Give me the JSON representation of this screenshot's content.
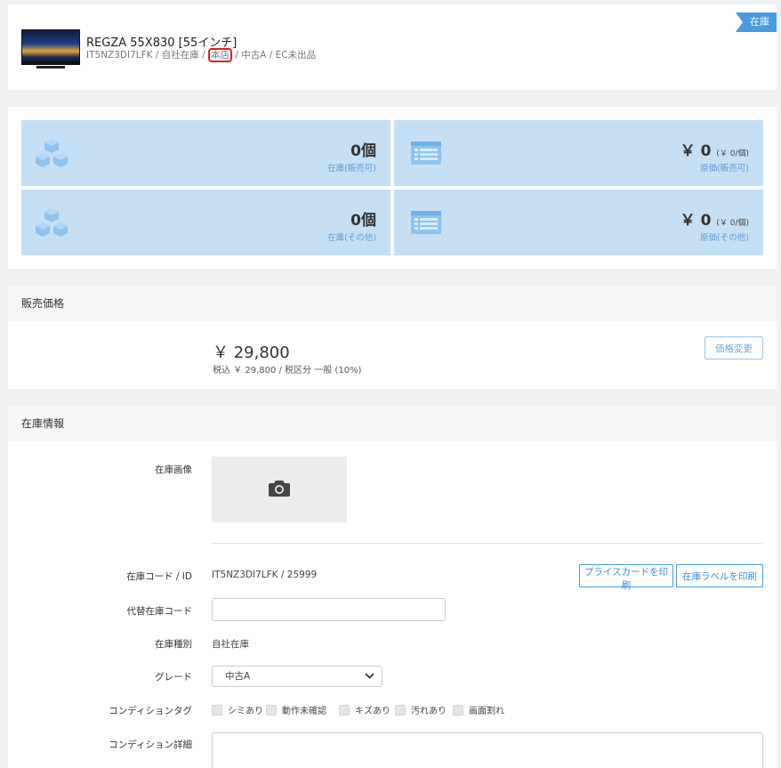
{
  "header": {
    "title": "REGZA 55X830 [55インチ]",
    "sub_prefix": "IT5NZ3DI7LFK / 自社在庫 /",
    "sub_store": "本店",
    "sub_suffix": "/ 中古A / EC未出品",
    "badge": "在庫"
  },
  "stats": [
    {
      "value": "0個",
      "label": "在庫(販売可)",
      "icon": "cubes-icon"
    },
    {
      "value": "￥ 0",
      "unit": "(￥ 0/個)",
      "label": "原価(販売可)",
      "icon": "list-icon"
    },
    {
      "value": "0個",
      "label": "在庫(その他)",
      "icon": "cubes-icon"
    },
    {
      "value": "￥ 0",
      "unit": "(￥ 0/個)",
      "label": "原価(その他)",
      "icon": "list-icon"
    }
  ],
  "price_section": {
    "heading": "販売価格",
    "price": "￥ 29,800",
    "tax_detail": "税込 ￥ 29,800 / 税区分 一般 (10%)",
    "change_button": "価格変更"
  },
  "stock_section": {
    "heading": "在庫情報",
    "image_label": "在庫画像",
    "code_label": "在庫コード / ID",
    "code_value": "IT5NZ3DI7LFK / 25999",
    "print_price_card": "プライスカードを印刷",
    "print_label": "在庫ラベルを印刷",
    "alt_code_label": "代替在庫コード",
    "alt_code_value": "",
    "type_label": "在庫種別",
    "type_value": "自社在庫",
    "grade_label": "グレード",
    "grade_value": "中古A",
    "condition_tag_label": "コンディションタグ",
    "condition_tags": [
      "シミあり",
      "動作未確認",
      "キズあり",
      "汚れあり",
      "画面割れ"
    ],
    "condition_detail_label": "コンディション詳細"
  },
  "colors": {
    "accent": "#4a9be0",
    "card_bg": "#c5e0f5",
    "highlight": "#e02020"
  }
}
